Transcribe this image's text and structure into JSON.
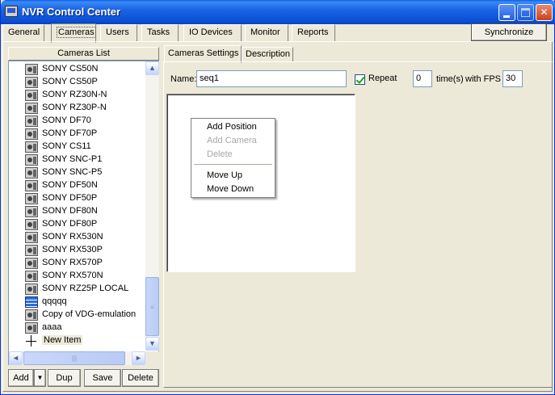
{
  "window": {
    "title": "NVR Control Center",
    "controls": {
      "minimize": "minimize",
      "maximize": "maximize",
      "close": "✕"
    }
  },
  "main_tabs": [
    "General",
    "Cameras",
    "Users",
    "Tasks",
    "IO Devices",
    "Monitor",
    "Reports"
  ],
  "active_main_tab": "Cameras",
  "synchronize_label": "Synchronize",
  "cameras_list": {
    "header": "Cameras List",
    "items": [
      {
        "label": "SONY CS50N",
        "icon": "camera-icon"
      },
      {
        "label": "SONY CS50P",
        "icon": "camera-icon"
      },
      {
        "label": "SONY RZ30N-N",
        "icon": "camera-icon"
      },
      {
        "label": "SONY RZ30P-N",
        "icon": "camera-icon"
      },
      {
        "label": "SONY DF70",
        "icon": "camera-icon"
      },
      {
        "label": "SONY DF70P",
        "icon": "camera-icon"
      },
      {
        "label": "SONY CS11",
        "icon": "camera-icon"
      },
      {
        "label": "SONY SNC-P1",
        "icon": "camera-icon"
      },
      {
        "label": "SONY SNC-P5",
        "icon": "camera-icon"
      },
      {
        "label": "SONY DF50N",
        "icon": "camera-icon"
      },
      {
        "label": "SONY DF50P",
        "icon": "camera-icon"
      },
      {
        "label": "SONY DF80N",
        "icon": "camera-icon"
      },
      {
        "label": "SONY DF80P",
        "icon": "camera-icon"
      },
      {
        "label": "SONY RX530N",
        "icon": "camera-icon"
      },
      {
        "label": "SONY RX530P",
        "icon": "camera-icon"
      },
      {
        "label": "SONY RX570P",
        "icon": "camera-icon"
      },
      {
        "label": "SONY RX570N",
        "icon": "camera-icon"
      },
      {
        "label": "SONY RZ25P LOCAL",
        "icon": "camera-icon"
      },
      {
        "label": "qqqqq",
        "icon": "sequence-icon"
      },
      {
        "label": "Copy of VDG-emulation",
        "icon": "camera-icon"
      },
      {
        "label": "aaaa",
        "icon": "camera-icon"
      },
      {
        "label": "New Item",
        "icon": "plus-icon"
      }
    ],
    "scroll_arrows": {
      "up": "▲",
      "down": "▼",
      "left": "◄",
      "right": "►"
    },
    "buttons": {
      "add": "Add",
      "add_arrow": "▼",
      "dup": "Dup",
      "save": "Save",
      "delete": "Delete"
    }
  },
  "settings": {
    "tabs": [
      "Cameras Settings",
      "Description"
    ],
    "active_tab": "Cameras Settings",
    "name_label": "Name:",
    "name_value": "seq1",
    "repeat_label": "Repeat",
    "repeat_checked": true,
    "repeat_times": "0",
    "times_label": "time(s)",
    "with_fps_label": "with FPS",
    "fps_value": "30"
  },
  "context_menu": {
    "items": [
      {
        "label": "Add Position",
        "enabled": true
      },
      {
        "label": "Add Camera",
        "enabled": false
      },
      {
        "label": "Delete",
        "enabled": false
      },
      {
        "label": "Move Up",
        "enabled": true
      },
      {
        "label": "Move Down",
        "enabled": true
      }
    ]
  }
}
